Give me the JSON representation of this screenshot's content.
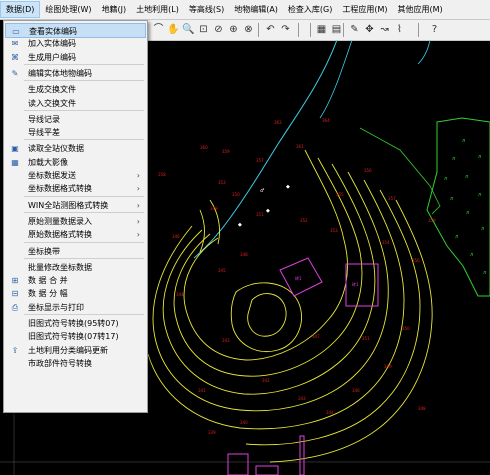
{
  "menubar": [
    {
      "label": "数据(D)",
      "active": true
    },
    {
      "label": "绘图处理(W)"
    },
    {
      "label": "地籍(J)"
    },
    {
      "label": "土地利用(L)"
    },
    {
      "label": "等高线(S)"
    },
    {
      "label": "地物编辑(A)"
    },
    {
      "label": "检查入库(G)"
    },
    {
      "label": "工程应用(M)"
    },
    {
      "label": "其他应用(M)"
    }
  ],
  "dropdown": {
    "items": [
      {
        "label": "查看实体编码",
        "icon": "query-code-icon",
        "highlighted": true
      },
      {
        "label": "加入实体编码",
        "icon": "add-code-icon"
      },
      {
        "label": "生成用户编码",
        "icon": "code-icon"
      },
      {
        "sep": true
      },
      {
        "label": "编辑实体地物编码",
        "icon": "edit-code-icon"
      },
      {
        "sep": true
      },
      {
        "label": "生成交换文件"
      },
      {
        "label": "读入交换文件"
      },
      {
        "sep": true
      },
      {
        "label": "导线记录"
      },
      {
        "label": "导线平差"
      },
      {
        "sep": true
      },
      {
        "label": "读取全站仪数据",
        "icon": "total-station-icon"
      },
      {
        "label": "加载大影像",
        "icon": "image-icon"
      },
      {
        "label": "坐标数据发送",
        "submenu": true
      },
      {
        "label": "坐标数据格式转换",
        "submenu": true
      },
      {
        "sep": true
      },
      {
        "label": "WIN全站测图格式转换",
        "submenu": true
      },
      {
        "sep": true
      },
      {
        "label": "原始测量数据录入",
        "submenu": true
      },
      {
        "label": "原始数据格式转换",
        "submenu": true
      },
      {
        "sep": true
      },
      {
        "label": "坐标换带"
      },
      {
        "sep": true
      },
      {
        "label": "批量修改坐标数据"
      },
      {
        "label": "数 据 合 并",
        "icon": "merge-icon"
      },
      {
        "label": "数 据 分 幅",
        "icon": "split-icon"
      },
      {
        "label": "坐标显示与打印",
        "icon": "print-icon"
      },
      {
        "sep": true
      },
      {
        "label": "旧图式符号转换(95转07)"
      },
      {
        "label": "旧图式符号转换(07转17)"
      },
      {
        "label": "土地利用分类编码更新",
        "icon": "update-icon"
      },
      {
        "label": "市政部件符号转换"
      }
    ]
  },
  "toolbar": {
    "icons": [
      "pline-icon",
      "pan-icon",
      "zoom-icon",
      "zoom-window-icon",
      "zoom-prev-icon",
      "zoom-extent-icon",
      "zoom-all-icon",
      "undo-icon",
      "redo-icon",
      "layer-icon",
      "properties-icon",
      "pen-icon",
      "move-icon",
      "snap-icon",
      "line-icon",
      "help-icon"
    ],
    "glyphs": [
      "⌒",
      "✋",
      "🔍",
      "⊡",
      "⊘",
      "⊕",
      "⊗",
      "↶",
      "↷",
      "▦",
      "▤",
      "✎",
      "✥",
      "↝",
      "⌇",
      "?"
    ]
  },
  "colors": {
    "menu_bg": "#f0f0f0",
    "highlight": "#c7dff4",
    "canvas": "#000000",
    "contour": "#e8e838",
    "road": "#3cd0e8",
    "building": "#e040e0",
    "vegetation": "#30d030"
  }
}
